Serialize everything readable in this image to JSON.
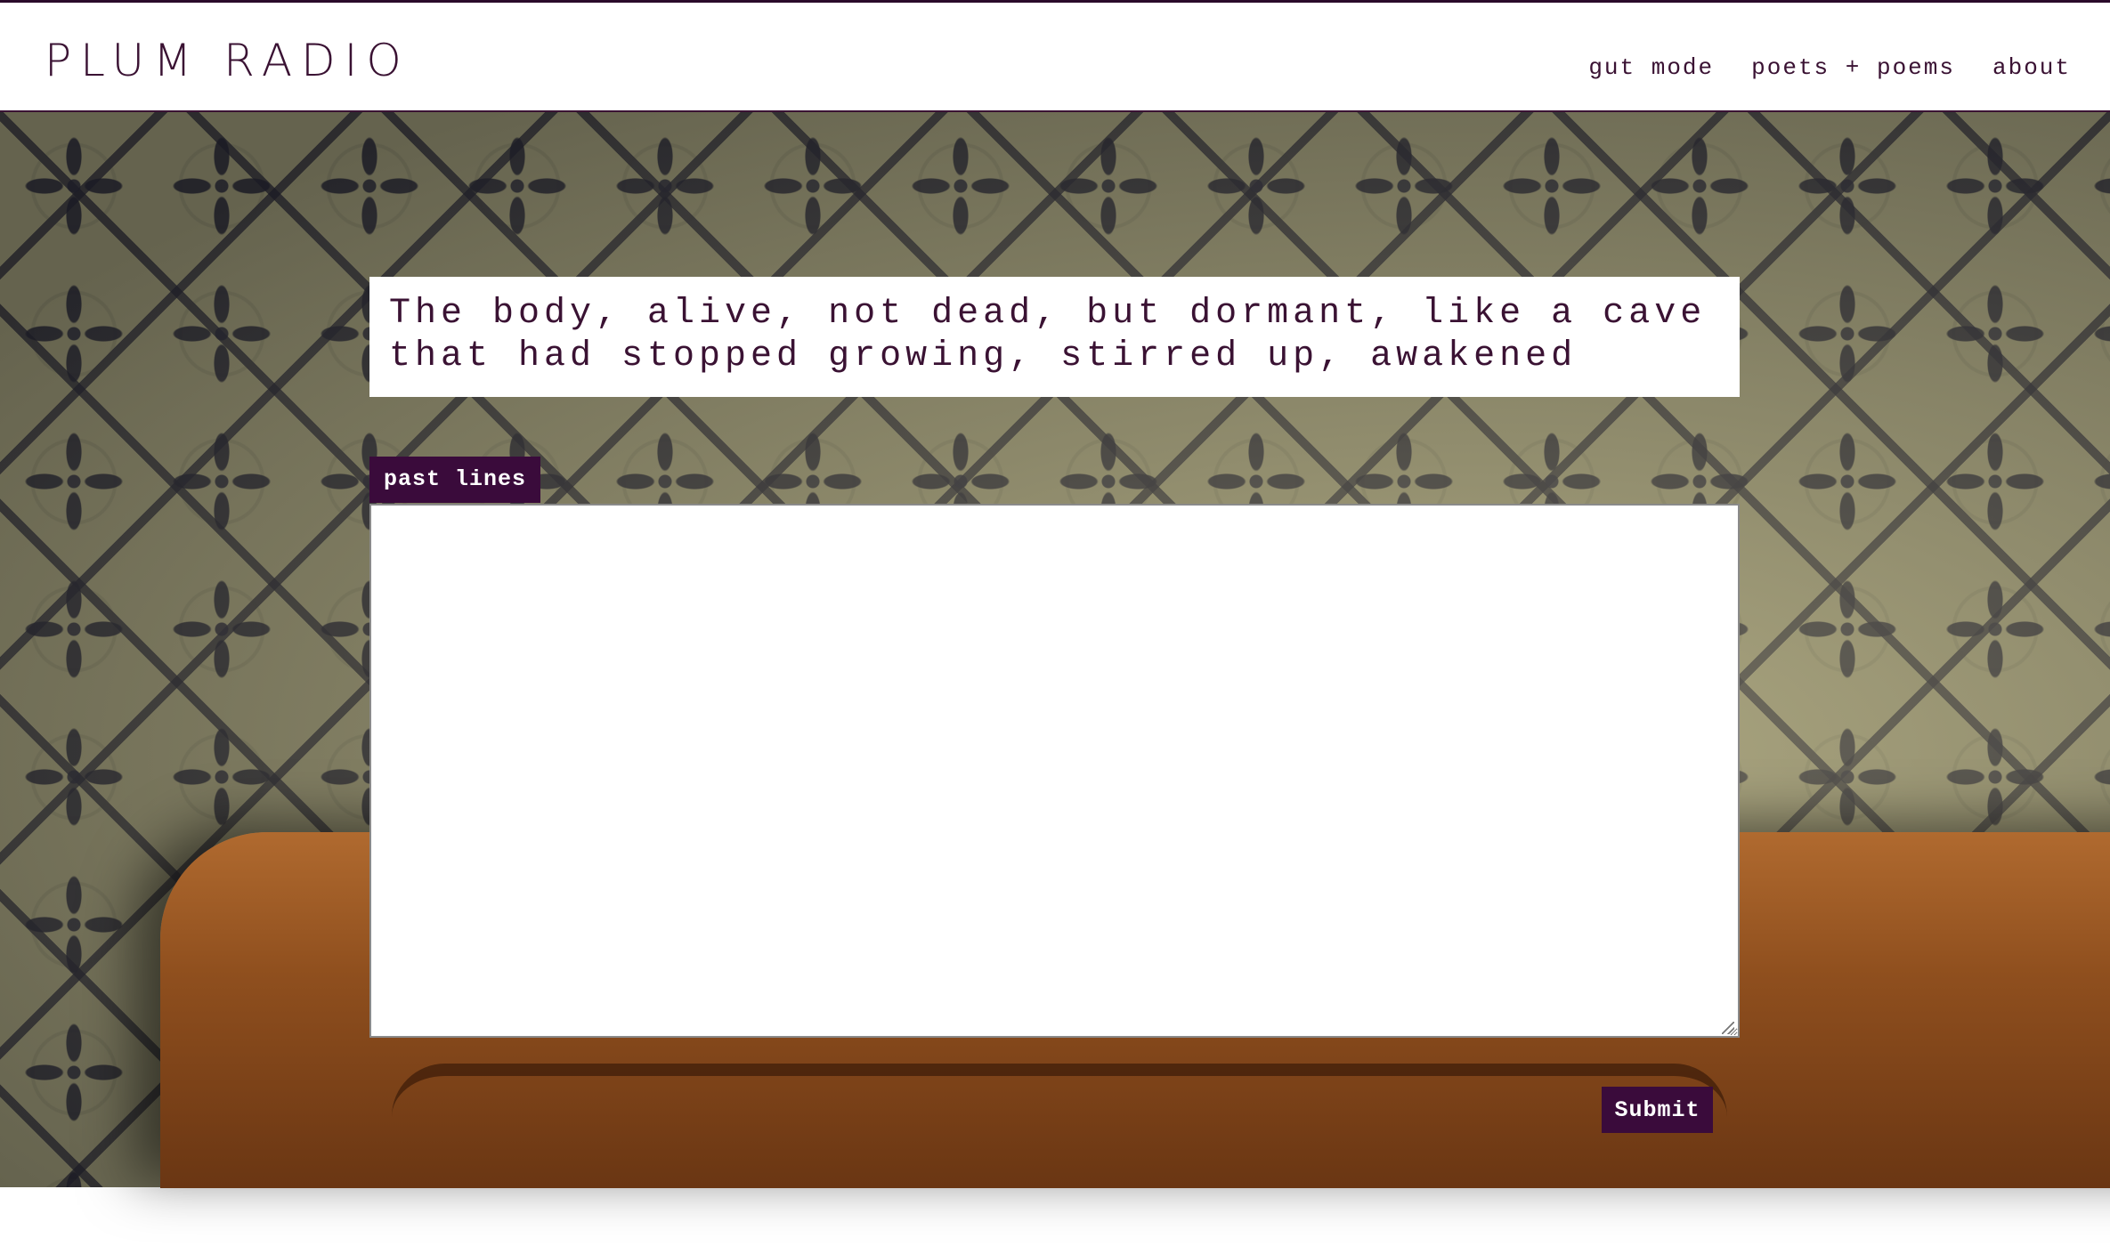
{
  "header": {
    "brand": "PLUM RADIO",
    "nav": [
      {
        "label": "gut mode"
      },
      {
        "label": "poets + poems"
      },
      {
        "label": "about"
      }
    ]
  },
  "prompt": {
    "line1": "The body, alive, not dead, but dormant, like a cave",
    "line2": "that had stopped growing, stirred up, awakened"
  },
  "past_lines": {
    "tag_label": "past lines",
    "value": ""
  },
  "submit": {
    "label": "Submit"
  },
  "colors": {
    "accent": "#3a0b3b",
    "text": "#3a1233"
  }
}
